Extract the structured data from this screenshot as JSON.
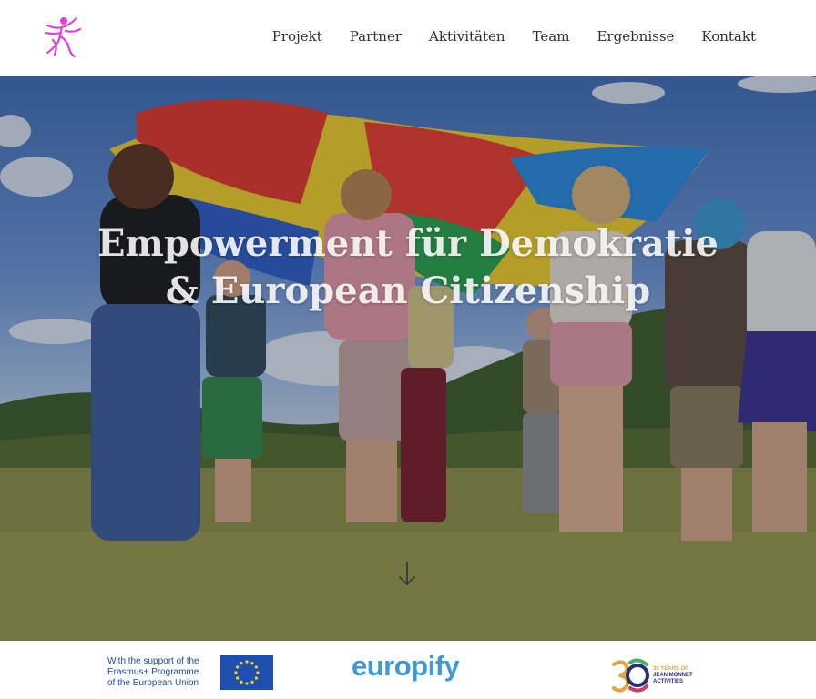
{
  "header": {
    "logo_icon": "dancer-logo-icon",
    "logo_color": "#e03ed8",
    "nav": [
      {
        "label": "Projekt"
      },
      {
        "label": "Partner"
      },
      {
        "label": "Aktivitäten"
      },
      {
        "label": "Team"
      },
      {
        "label": "Ergebnisse"
      },
      {
        "label": "Kontakt"
      }
    ]
  },
  "hero": {
    "title_line1": "Empowerment für Demokratie",
    "title_line2": "& European Citizenship",
    "scroll_icon": "arrow-down-icon"
  },
  "footer": {
    "erasmus_text_line1": "With the support of the",
    "erasmus_text_line2": "Erasmus+ Programme",
    "erasmus_text_line3": "of the European Union",
    "europify_label": "europify",
    "jean_monnet_line1": "30 YEARS OF",
    "jean_monnet_line2": "JEAN MONNET",
    "jean_monnet_line3": "ACTIVITIES"
  },
  "colors": {
    "nav_text": "#2b2f3a",
    "eu_blue": "#1f4fae",
    "eu_star": "#ffd500",
    "europify_blue": "#3d9ad8",
    "jm_navy": "#2a2f7a"
  }
}
